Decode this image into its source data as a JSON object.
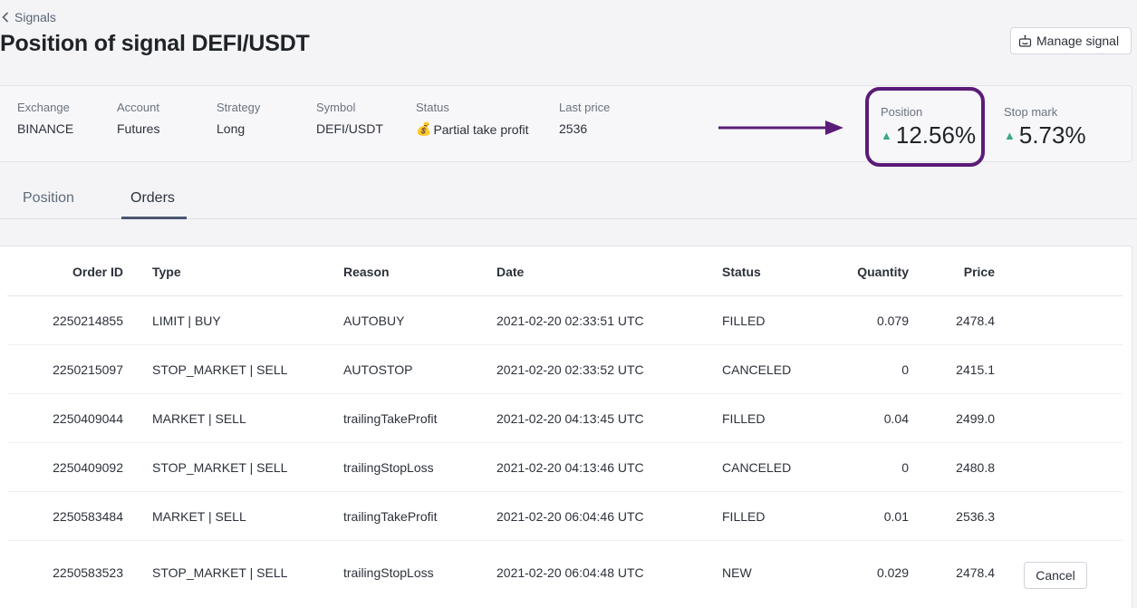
{
  "breadcrumb": {
    "label": "Signals"
  },
  "page_title": "Position of signal DEFI/USDT",
  "actions": {
    "manage_signal": "Manage signal"
  },
  "info": {
    "exchange": {
      "label": "Exchange",
      "value": "BINANCE"
    },
    "account": {
      "label": "Account",
      "value": "Futures"
    },
    "strategy": {
      "label": "Strategy",
      "value": "Long"
    },
    "symbol": {
      "label": "Symbol",
      "value": "DEFI/USDT"
    },
    "status": {
      "label": "Status",
      "icon": "money-bag",
      "value": "Partial take profit"
    },
    "last_price": {
      "label": "Last price",
      "value": "2536"
    },
    "position": {
      "label": "Position",
      "value": "12.56%",
      "trend": "up"
    },
    "stop_mark": {
      "label": "Stop mark",
      "value": "5.73%",
      "trend": "up"
    }
  },
  "colors": {
    "highlight": "#5b1b78",
    "up": "#3aa88a"
  },
  "tabs": [
    {
      "label": "Position",
      "active": false
    },
    {
      "label": "Orders",
      "active": true
    }
  ],
  "orders": {
    "columns": [
      "Order ID",
      "Type",
      "Reason",
      "Date",
      "Status",
      "Quantity",
      "Price"
    ],
    "rows": [
      {
        "order_id": "2250214855",
        "type": "LIMIT | BUY",
        "reason": "AUTOBUY",
        "date": "2021-02-20 02:33:51 UTC",
        "status": "FILLED",
        "quantity": "0.079",
        "price": "2478.4"
      },
      {
        "order_id": "2250215097",
        "type": "STOP_MARKET | SELL",
        "reason": "AUTOSTOP",
        "date": "2021-02-20 02:33:52 UTC",
        "status": "CANCELED",
        "quantity": "0",
        "price": "2415.1"
      },
      {
        "order_id": "2250409044",
        "type": "MARKET | SELL",
        "reason": "trailingTakeProfit",
        "date": "2021-02-20 04:13:45 UTC",
        "status": "FILLED",
        "quantity": "0.04",
        "price": "2499.0"
      },
      {
        "order_id": "2250409092",
        "type": "STOP_MARKET | SELL",
        "reason": "trailingStopLoss",
        "date": "2021-02-20 04:13:46 UTC",
        "status": "CANCELED",
        "quantity": "0",
        "price": "2480.8"
      },
      {
        "order_id": "2250583484",
        "type": "MARKET | SELL",
        "reason": "trailingTakeProfit",
        "date": "2021-02-20 06:04:46 UTC",
        "status": "FILLED",
        "quantity": "0.01",
        "price": "2536.3"
      },
      {
        "order_id": "2250583523",
        "type": "STOP_MARKET | SELL",
        "reason": "trailingStopLoss",
        "date": "2021-02-20 06:04:48 UTC",
        "status": "NEW",
        "quantity": "0.029",
        "price": "2478.4",
        "action": "Cancel"
      }
    ]
  }
}
